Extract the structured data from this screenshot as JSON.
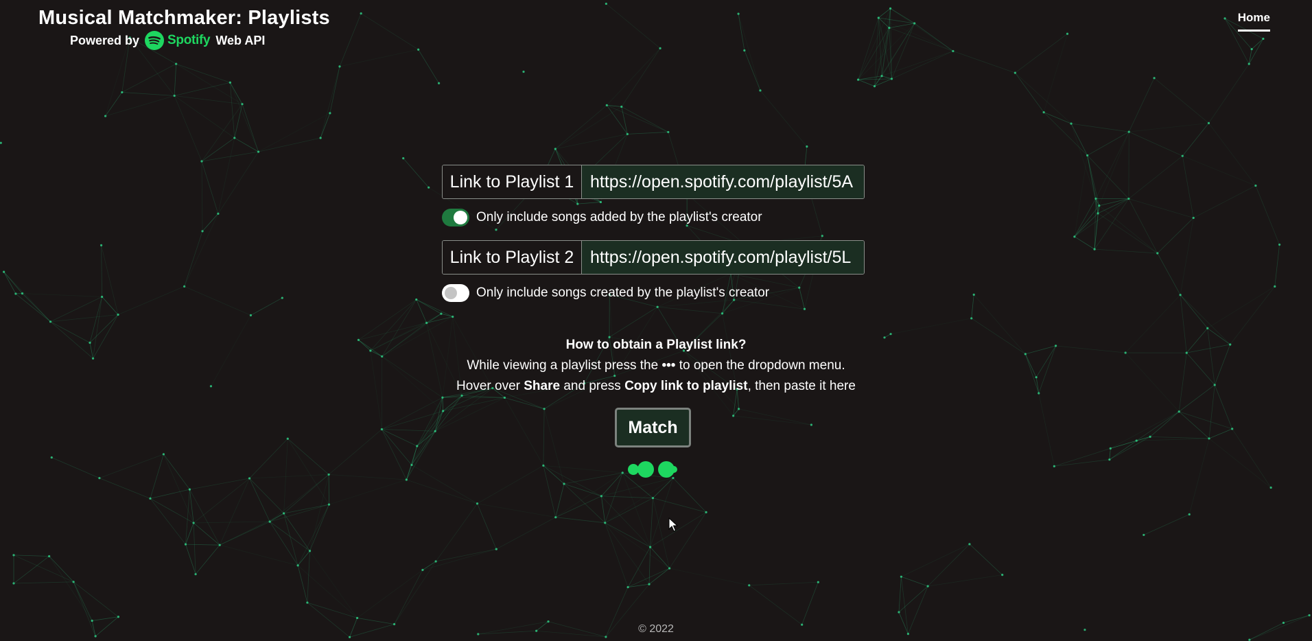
{
  "header": {
    "title": "Musical Matchmaker: Playlists",
    "powered_prefix": "Powered by",
    "brand_name": "Spotify",
    "powered_suffix": "Web API"
  },
  "nav": {
    "home_label": "Home"
  },
  "playlist1": {
    "label": "Link to Playlist 1",
    "value": "https://open.spotify.com/playlist/5A",
    "toggle_on": true,
    "toggle_label": "Only include songs added by the playlist's creator"
  },
  "playlist2": {
    "label": "Link to Playlist 2",
    "value": "https://open.spotify.com/playlist/5L",
    "toggle_on": false,
    "toggle_label": "Only include songs created by the playlist's creator"
  },
  "help": {
    "heading": "How to obtain a Playlist link?",
    "line1_before": "While viewing a playlist press the",
    "line1_dots": "•••",
    "line1_after": "to open the dropdown menu.",
    "line2_a": "Hover over",
    "line2_share": "Share",
    "line2_b": "and press",
    "line2_copy": "Copy link to playlist",
    "line2_c": ", then paste it here"
  },
  "match_button": {
    "label": "Match"
  },
  "footer": {
    "copyright": "© 2022"
  },
  "colors": {
    "background": "#1a1616",
    "accent": "#1ed760",
    "network_nodes": "#2fd58a",
    "input_bg": "#1b2e22",
    "toggle_on": "#1f7a3f"
  }
}
